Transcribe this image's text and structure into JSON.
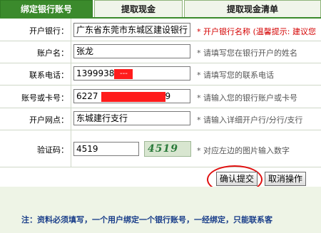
{
  "tabs": [
    {
      "label": "绑定银行账号",
      "active": true
    },
    {
      "label": "提取现金",
      "active": false
    },
    {
      "label": "提取现金清单",
      "active": false
    }
  ],
  "form": {
    "bank": {
      "label": "开户银行：",
      "value": "广东省东莞市东城区建设银行",
      "hint": "* 开户银行名称 (温馨提示: 建议您"
    },
    "account_name": {
      "label": "账户名：",
      "value": "张龙",
      "hint": "* 请填写您在银行开户的姓名"
    },
    "phone": {
      "label": "联系电话：",
      "value_visible": "1399938",
      "redacted_text": "---",
      "hint": "* 请填写您的联系电话"
    },
    "account_number": {
      "label": "账号或卡号：",
      "value_prefix": "6227",
      "value_suffix": "9",
      "hint": "* 请输入您的银行账户或卡号"
    },
    "branch": {
      "label": "开户网点：",
      "value": "东城建行支行",
      "hint": "* 请输入详细开户行/分行/支行"
    },
    "captcha": {
      "label": "验证码：",
      "value": "4519",
      "image_text": "4519",
      "hint": "* 对应左边的图片输入数字"
    }
  },
  "buttons": {
    "submit": "确认提交",
    "cancel": "取消操作"
  },
  "footer": {
    "note": "注：资料必须填写，一个用户绑定一个银行账号，一经绑定，只能联系客"
  },
  "colors": {
    "tab_active": "#3b8a2c",
    "hint_red": "#d40000",
    "note_blue": "#1b3f8a",
    "highlight_circle": "#e01010"
  }
}
